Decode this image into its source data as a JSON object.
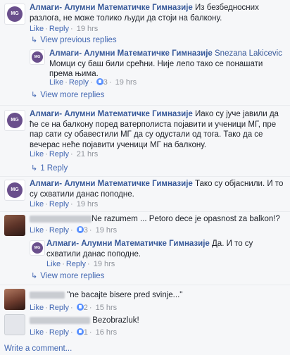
{
  "page_name": "Алмаги- Алумни Математичке Гимназије",
  "avatar_initials": "MG",
  "actions": {
    "like": "Like",
    "reply": "Reply",
    "view_previous": "View previous replies",
    "view_more": "View more replies",
    "write": "Write a comment..."
  },
  "comments": [
    {
      "text": "Из безбедносних разлога, не може толико људи да стоји на балкону.",
      "time": "19 hrs"
    },
    {
      "reply_to": "Snezana Lakicevic",
      "text": "Момци су баш били срећни. Није лепо тако се понашати према њима.",
      "likes": "3",
      "time": "19 hrs"
    },
    {
      "text": "Иако су јуче јавили да ће се на балкону поред ватерполиста појавити и ученици МГ, пре пар сати су обавестили МГ да су одустали од тога. Тако да се вечерас неће појавити ученици МГ на балкону.",
      "time": "21 hrs",
      "replies": "1 Reply"
    },
    {
      "text": "Тако су објаснили. И то су схватили данас поподне.",
      "time": "19 hrs"
    },
    {
      "text": "Ne razumem ... Petoro dece je opasnost za balkon!?",
      "likes": "3",
      "time": "19 hrs"
    },
    {
      "text": "Да. И то су схватили данас поподне.",
      "time": "19 hrs"
    },
    {
      "text": "\"ne bacajte bisere pred svinje...\"",
      "likes": "2",
      "time": "15 hrs"
    },
    {
      "text": "Bezobrazluk!",
      "likes": "1",
      "time": "16 hrs"
    }
  ]
}
